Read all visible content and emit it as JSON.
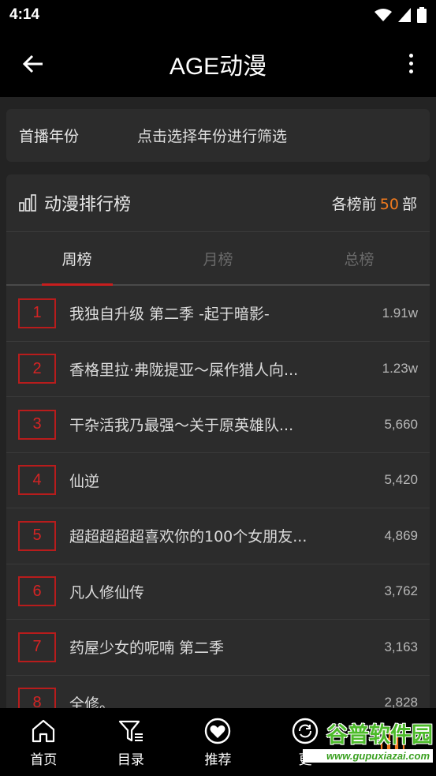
{
  "status": {
    "time": "4:14"
  },
  "appbar": {
    "title": "AGE动漫",
    "back_icon": "arrow-left-icon",
    "more_icon": "more-vertical-icon"
  },
  "filter": {
    "label": "首播年份",
    "hint": "点击选择年份进行筛选"
  },
  "ranking": {
    "title": "动漫排行榜",
    "top_prefix": "各榜前",
    "top_number": "50",
    "top_suffix": "部",
    "tabs": [
      {
        "label": "周榜",
        "active": true
      },
      {
        "label": "月榜",
        "active": false
      },
      {
        "label": "总榜",
        "active": false
      }
    ],
    "items": [
      {
        "rank": "1",
        "title": "我独自升级 第二季 -起于暗影-",
        "count": "1.91w"
      },
      {
        "rank": "2",
        "title": "香格里拉·弗陇提亚～屎作猎人向...",
        "count": "1.23w"
      },
      {
        "rank": "3",
        "title": "干杂活我乃最强～关于原英雄队...",
        "count": "5,660"
      },
      {
        "rank": "4",
        "title": "仙逆",
        "count": "5,420"
      },
      {
        "rank": "5",
        "title": "超超超超超喜欢你的100个女朋友...",
        "count": "4,869"
      },
      {
        "rank": "6",
        "title": "凡人修仙传",
        "count": "3,762"
      },
      {
        "rank": "7",
        "title": "药屋少女的呢喃 第二季",
        "count": "3,163"
      },
      {
        "rank": "8",
        "title": "全修。",
        "count": "2,828"
      }
    ]
  },
  "bottom_nav": [
    {
      "label": "首页",
      "icon": "home-icon"
    },
    {
      "label": "目录",
      "icon": "filter-list-icon"
    },
    {
      "label": "推荐",
      "icon": "heart-circle-icon"
    },
    {
      "label": "更",
      "icon": "refresh-circle-icon"
    },
    {
      "label": "",
      "icon": "ranking-icon"
    }
  ],
  "watermark": {
    "text": "谷普软件园",
    "url": "www.gupuxiazai.com"
  },
  "colors": {
    "accent_red": "#c81e1e",
    "accent_orange": "#f07a1e",
    "watermark_green": "#4cbb2a"
  }
}
